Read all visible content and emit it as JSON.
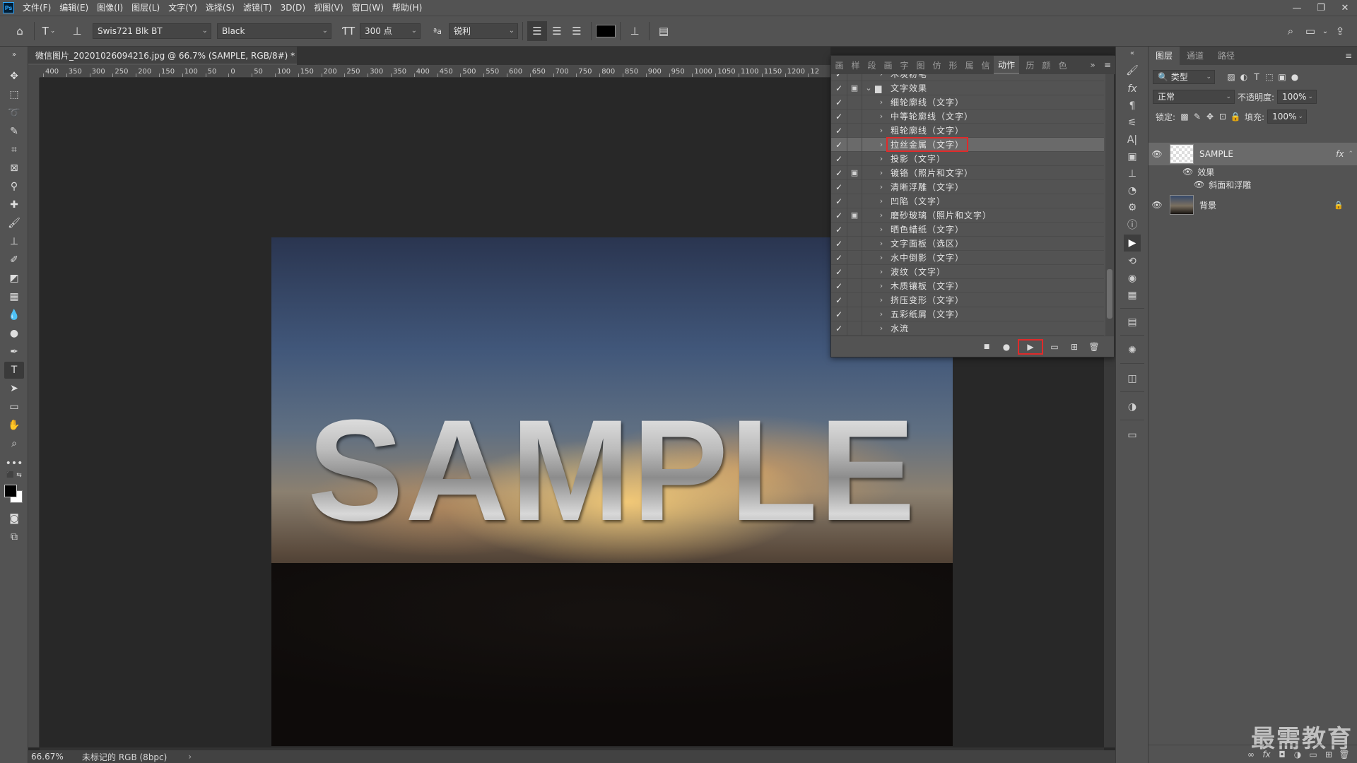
{
  "menubar": {
    "logo": "Ps",
    "items": [
      "文件(F)",
      "编辑(E)",
      "图像(I)",
      "图层(L)",
      "文字(Y)",
      "选择(S)",
      "滤镜(T)",
      "3D(D)",
      "视图(V)",
      "窗口(W)",
      "帮助(H)"
    ],
    "window_buttons": [
      "—",
      "❐",
      "✕"
    ]
  },
  "options": {
    "font_family": "Swis721 Blk BT",
    "font_style": "Black",
    "font_size": "300 点",
    "aa_label": "ªa",
    "antialias": "锐利",
    "text_color": "#000000"
  },
  "document": {
    "tab_title": "微信图片_20201026094216.jpg @ 66.7% (SAMPLE, RGB/8#) *",
    "tab_close": "×",
    "canvas_text": "SAMPLE",
    "ruler_labels": [
      "400",
      "350",
      "300",
      "250",
      "200",
      "150",
      "100",
      "50",
      "0",
      "50",
      "100",
      "150",
      "200",
      "250",
      "300",
      "350",
      "400",
      "450",
      "500",
      "550",
      "600",
      "650",
      "700",
      "750",
      "800",
      "850",
      "900",
      "950",
      "1000",
      "1050",
      "1100",
      "1150",
      "1200",
      "12"
    ]
  },
  "status": {
    "zoom": "66.67%",
    "info": "未标记的 RGB (8bpc)",
    "arrow": "›"
  },
  "actions_panel": {
    "tab_glyphs": [
      "画",
      "样",
      "段",
      "画",
      "字",
      "图",
      "仿",
      "形",
      "属",
      "信"
    ],
    "active_tab": "动作",
    "tab_glyphs_after": [
      "历",
      "颜",
      "色"
    ],
    "more": "»",
    "menu": "≡",
    "rows": [
      {
        "label": "木炭粉笔",
        "dialog": false,
        "folder": false,
        "expand": "›",
        "partial": true
      },
      {
        "label": "文字效果",
        "dialog": true,
        "folder": true,
        "expand": "⌄"
      },
      {
        "label": "细轮廓线（文字）",
        "dialog": false,
        "expand": "›"
      },
      {
        "label": "中等轮廓线（文字）",
        "dialog": false,
        "expand": "›"
      },
      {
        "label": "粗轮廓线（文字）",
        "dialog": false,
        "expand": "›"
      },
      {
        "label": "拉丝金属（文字）",
        "dialog": false,
        "expand": "›",
        "selected": true
      },
      {
        "label": "投影（文字）",
        "dialog": false,
        "expand": "›"
      },
      {
        "label": "镀铬（照片和文字）",
        "dialog": true,
        "expand": "›"
      },
      {
        "label": "清晰浮雕（文字）",
        "dialog": false,
        "expand": "›"
      },
      {
        "label": "凹陷（文字）",
        "dialog": false,
        "expand": "›"
      },
      {
        "label": "磨砂玻璃（照片和文字）",
        "dialog": true,
        "expand": "›"
      },
      {
        "label": "晒色蜡纸（文字）",
        "dialog": false,
        "expand": "›"
      },
      {
        "label": "文字面板（选区）",
        "dialog": false,
        "expand": "›"
      },
      {
        "label": "水中倒影（文字）",
        "dialog": false,
        "expand": "›"
      },
      {
        "label": "波纹（文字）",
        "dialog": false,
        "expand": "›"
      },
      {
        "label": "木质镶板（文字）",
        "dialog": false,
        "expand": "›"
      },
      {
        "label": "挤压变形（文字）",
        "dialog": false,
        "expand": "›"
      },
      {
        "label": "五彩纸屑（文字）",
        "dialog": false,
        "expand": "›"
      },
      {
        "label": "水流",
        "dialog": false,
        "expand": "›"
      }
    ],
    "check": "✓",
    "dialog_icon": "▣",
    "folder_icon": "▆",
    "footer_buttons": [
      "■",
      "●",
      "▶",
      "▭",
      "⊞",
      "🗑"
    ]
  },
  "layers_panel": {
    "tabs": [
      "图层",
      "通道",
      "路径"
    ],
    "menu": "≡",
    "filter_label": "类型",
    "filter_icon": "🔍",
    "blend_mode": "正常",
    "opacity_label": "不透明度:",
    "opacity": "100%",
    "lock_label": "锁定:",
    "fill_label": "填充:",
    "fill": "100%",
    "layers": [
      {
        "name": "SAMPLE",
        "fx": "fx",
        "selected": true
      },
      {
        "name": "背景",
        "locked": true
      }
    ],
    "effects_label": "效果",
    "effect_item": "斜面和浮雕",
    "footer_buttons": [
      "∞",
      "fx",
      "◘",
      "◑",
      "▭",
      "⊞",
      "🗑"
    ]
  },
  "watermark": "最需教育",
  "colors": {
    "ui_bg": "#535353",
    "canvas_bg": "#282828",
    "highlight_red": "#e02a2a",
    "selected_row": "#6a6a6a"
  }
}
